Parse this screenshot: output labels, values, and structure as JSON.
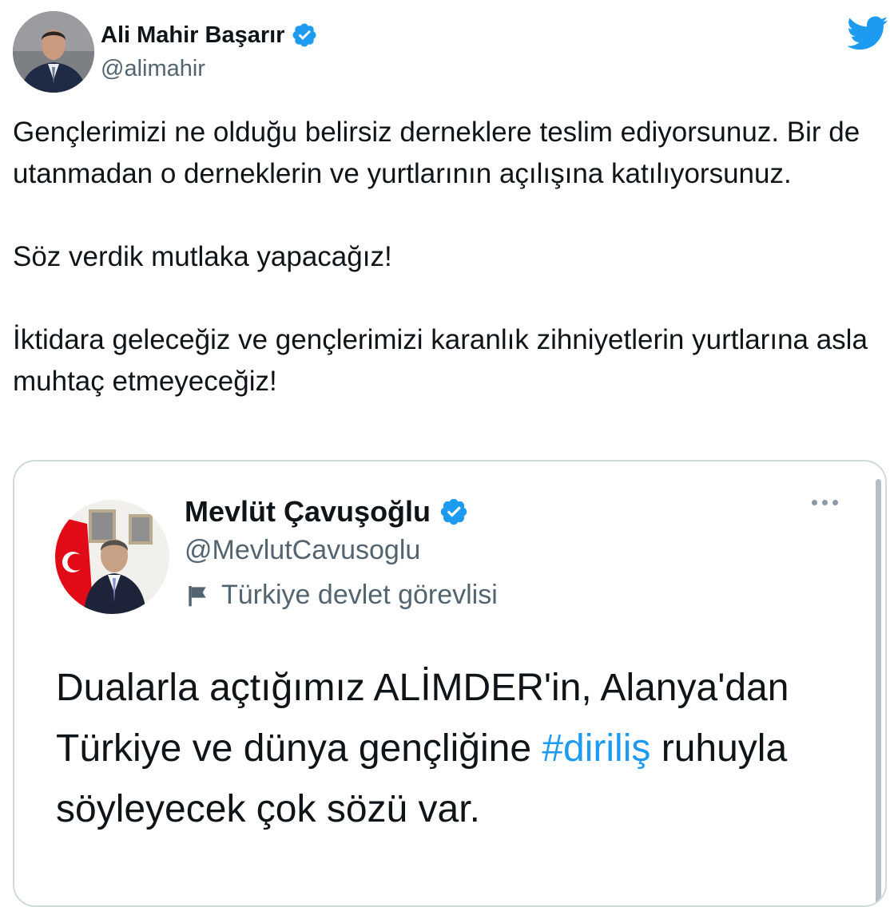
{
  "author": {
    "name": "Ali Mahir Başarır",
    "handle": "@alimahir"
  },
  "tweet": {
    "paragraphs": [
      "Gençlerimizi ne olduğu belirsiz derneklere teslim ediyorsunuz. Bir de utanmadan o derneklerin ve yurtlarının açılışına katılıyorsunuz.",
      "Söz verdik mutlaka yapacağız!",
      "İktidara geleceğiz ve gençlerimizi karanlık zihniyetlerin yurtlarına asla muhtaç etmeyeceğiz!"
    ]
  },
  "quoted": {
    "name": "Mevlüt Çavuşoğlu",
    "handle": "@MevlutCavusoglu",
    "label": "Türkiye devlet görevlisi",
    "text_before": "Dualarla açtığımız ALİMDER'in, Alanya'dan Türkiye ve dünya gençliğine ",
    "hashtag": "#diriliş",
    "text_after": " ruhuyla söyleyecek çok sözü var."
  },
  "icons": [
    "twitter-bird-icon",
    "verified-badge-icon",
    "government-flag-icon",
    "more-options-icon"
  ],
  "colors": {
    "brand": "#1d9bf0",
    "text": "#0f1419",
    "secondary": "#536471"
  }
}
